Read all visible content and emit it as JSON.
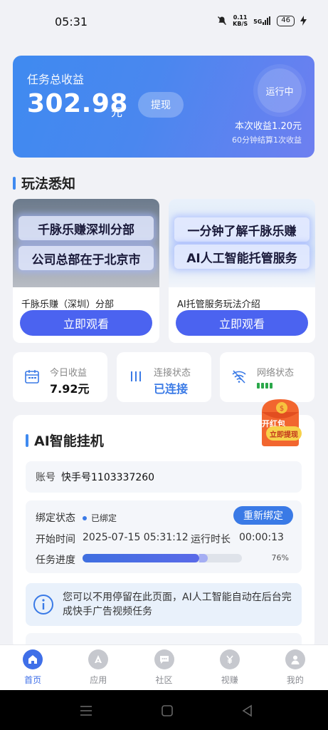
{
  "status_bar": {
    "time": "05:31",
    "net_speed_value": "0.11",
    "net_speed_unit": "KB/S",
    "network": "5G",
    "battery": "46"
  },
  "earnings": {
    "title": "任务总收益",
    "amount": "302.98",
    "unit": "元",
    "withdraw_label": "提现",
    "running_label": "运行中",
    "session_earnings": "本次收益1.20元",
    "settle_note": "60分钟结算1次收益"
  },
  "section_howto": {
    "title": "玩法悉知"
  },
  "videos": [
    {
      "thumb_line1": "千脉乐赚深圳分部",
      "thumb_line2": "公司总部在于北京市",
      "caption": "千脉乐赚（深圳）分部",
      "button": "立即观看"
    },
    {
      "thumb_line1": "一分钟了解千脉乐赚",
      "thumb_line2": "AI人工智能托管服务",
      "caption": "AI托管服务玩法介绍",
      "button": "立即观看"
    }
  ],
  "stats": {
    "today": {
      "label": "今日收益",
      "value": "7.92元"
    },
    "connection": {
      "label": "连接状态",
      "value": "已连接"
    },
    "network": {
      "label": "网络状态"
    }
  },
  "red_packet": {
    "label": "开红包",
    "button": "立即提现"
  },
  "ai_card": {
    "title": "AI智能挂机",
    "account_key": "账号",
    "account_value": "快手号1103337260",
    "bind_label": "绑定状态",
    "bind_value": "已绑定",
    "rebind_label": "重新绑定",
    "start_label": "开始时间",
    "start_value": "2025-07-15 05:31:12",
    "runtime_label": "运行时长",
    "runtime_value": "00:00:13",
    "progress_label": "任务进度",
    "progress_value": 76,
    "progress_text": "76%",
    "info_text": "您可以不用停留在此页面，AI人工智能自动在后台完成快手广告视频任务"
  },
  "tabs": [
    {
      "label": "首页",
      "icon": "home-icon",
      "active": true
    },
    {
      "label": "应用",
      "icon": "app-icon",
      "active": false
    },
    {
      "label": "社区",
      "icon": "chat-icon",
      "active": false
    },
    {
      "label": "视赚",
      "icon": "yuan-icon",
      "active": false
    },
    {
      "label": "我的",
      "icon": "user-icon",
      "active": false
    }
  ],
  "colors": {
    "accent": "#3f6fe8",
    "card_gradient_start": "#3f8af0",
    "watch_button": "#4b63f0",
    "connected": "#3a7ae6",
    "signal": "#2ba84a"
  }
}
